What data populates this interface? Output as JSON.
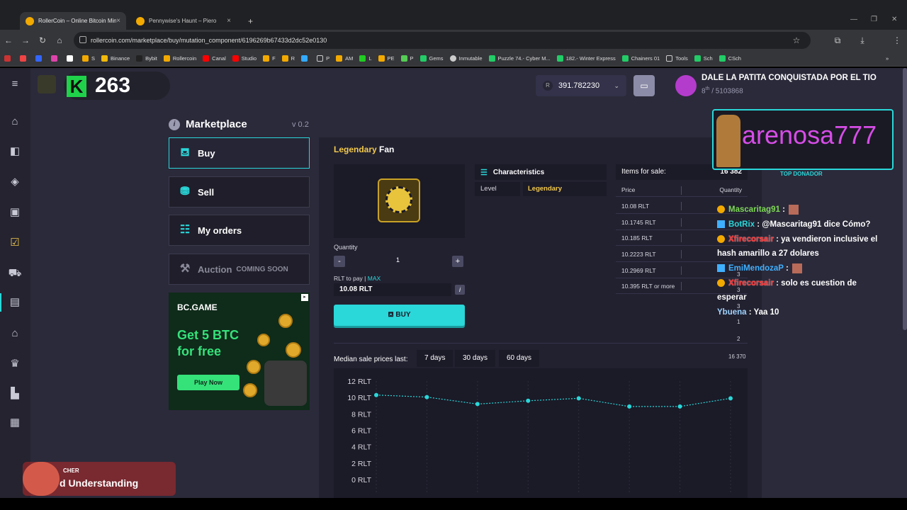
{
  "browser": {
    "tabs": [
      {
        "title": "RollerCoin – Online Bitcoin Mini",
        "active": true
      },
      {
        "title": "Pennywise's Haunt – Piero",
        "active": false
      }
    ],
    "new_tab": "+",
    "url": "rollercoin.com/marketplace/buy/mutation_component/6196269b67433d2dc52e0130",
    "bookmarks": [
      "S",
      "Binance",
      "Bybit",
      "Rollercoin",
      "Canal",
      "Studio",
      "F",
      "R",
      "P",
      "AM",
      "L",
      "PE",
      "P",
      "Gems",
      "Inmutable",
      "Puzzle 74.- Cyber M...",
      "182.- Winter Express",
      "Chainers 01",
      "Tools",
      "Sch",
      "CSch"
    ],
    "more": "»"
  },
  "header": {
    "k_letter": "K",
    "level": "263",
    "balance_currency": "R",
    "balance": "391.782230",
    "user_name": "DALE LA PATITA CONQUISTADA POR EL TIO",
    "user_rank": "8",
    "user_rank_sup": "th",
    "user_total": "/ 5103868"
  },
  "sidebar_menu": {
    "title": "Marketplace",
    "version": "v 0.2",
    "buy": "Buy",
    "sell": "Sell",
    "orders": "My orders",
    "auction": "Auction",
    "coming_soon": "COMING SOON"
  },
  "ad": {
    "brand": "BC.GAME",
    "line1": "Get 5 BTC",
    "line2": "for free",
    "cta": "Play Now"
  },
  "item": {
    "rarity": "Legendary",
    "name": "Fan",
    "quantity_label": "Quantity",
    "quantity": "1",
    "minus": "-",
    "plus": "+",
    "pay_label": "RLT to pay |",
    "max": "MAX",
    "pay_value": "10.08 RLT",
    "info": "i",
    "buy": "BUY"
  },
  "characteristics": {
    "title": "Characteristics",
    "level_label": "Level",
    "level_value": "Legendary"
  },
  "orderbook": {
    "title": "Items for sale:",
    "count": "16 382",
    "col_price": "Price",
    "col_qty": "Quantity",
    "rows": [
      {
        "price": "10.08 RLT",
        "qty": "3"
      },
      {
        "price": "10.1745 RLT",
        "qty": "3"
      },
      {
        "price": "10.185 RLT",
        "qty": "3"
      },
      {
        "price": "10.2223 RLT",
        "qty": "1"
      },
      {
        "price": "10.2969 RLT",
        "qty": "2"
      },
      {
        "price": "10.395 RLT or more",
        "qty": "16 370"
      }
    ]
  },
  "median": {
    "label": "Median sale prices last:",
    "tabs": [
      "7 days",
      "30 days",
      "60 days"
    ]
  },
  "chart_data": {
    "type": "line",
    "yticks": [
      "12 RLT",
      "10 RLT",
      "8 RLT",
      "6 RLT",
      "4 RLT",
      "2 RLT",
      "0 RLT"
    ],
    "ylim": [
      0,
      12
    ],
    "values": [
      10.3,
      10.05,
      9.2,
      9.6,
      9.9,
      8.9,
      8.9,
      9.9
    ],
    "color": "#2ad7d9"
  },
  "overlay": {
    "donor_name": "arenosa777",
    "donor_label": "TOP DONADOR",
    "chat": [
      {
        "user": "Mascaritag91",
        "text": ":"
      },
      {
        "user": "BotRix",
        "text": ": @Mascaritag91 dice Cómo?"
      },
      {
        "user": "Xfirecorsair",
        "text": ": ya vendieron inclusive el hash amarillo a 27 dolares"
      },
      {
        "user": "EmiMendozaP",
        "text": ":"
      },
      {
        "user": "Xfirecorsair",
        "text": ": solo es cuestion de esperar"
      },
      {
        "user": "Ybuena",
        "text": ": Yaa 10"
      }
    ],
    "music_artist": "CHER",
    "music_title": "d Understanding"
  }
}
